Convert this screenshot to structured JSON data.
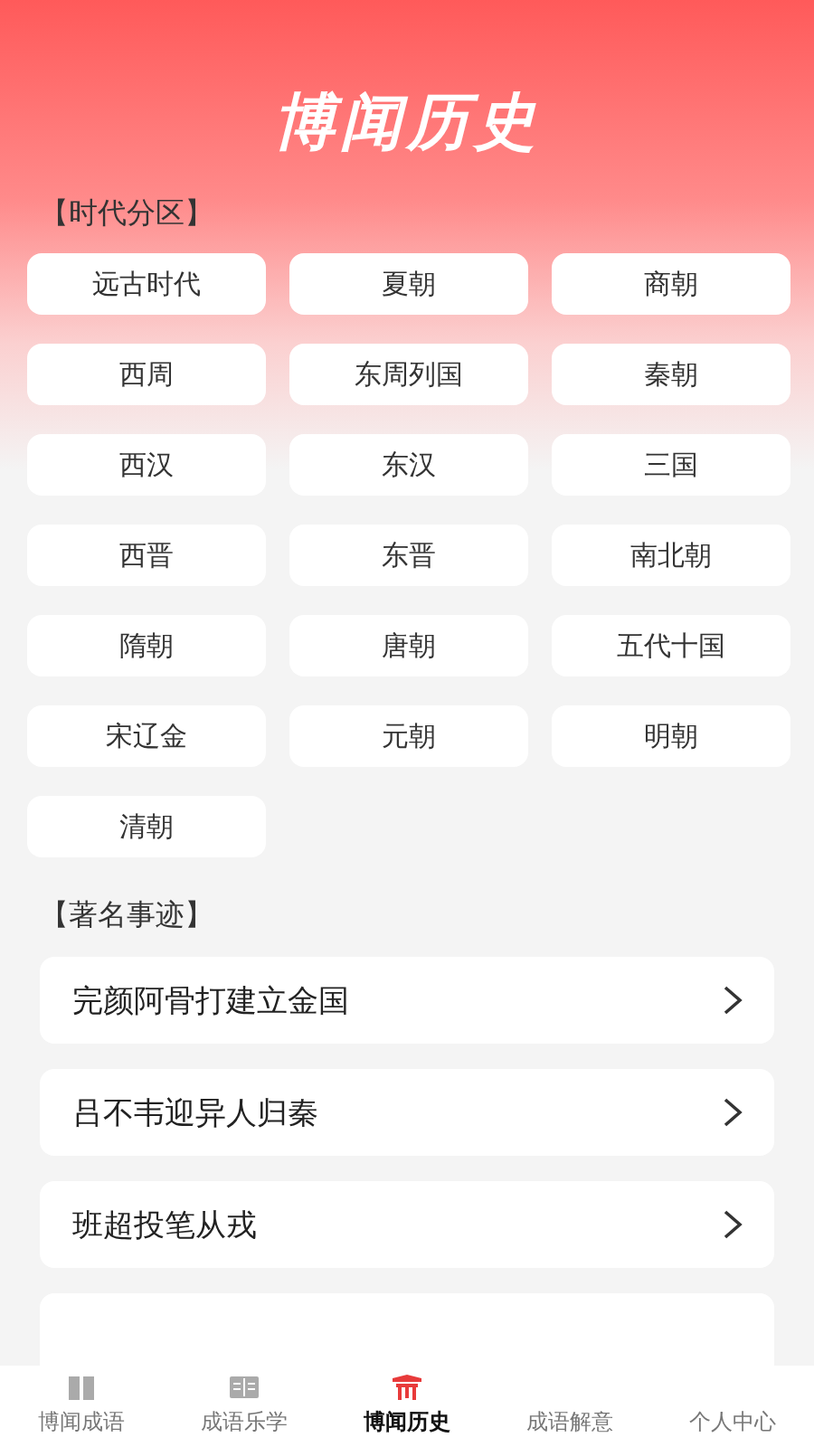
{
  "header": {
    "title": "博闻历史"
  },
  "eras": {
    "heading": "【时代分区】",
    "items": [
      "远古时代",
      "夏朝",
      "商朝",
      "西周",
      "东周列国",
      "秦朝",
      "西汉",
      "东汉",
      "三国",
      "西晋",
      "东晋",
      "南北朝",
      "隋朝",
      "唐朝",
      "五代十国",
      "宋辽金",
      "元朝",
      "明朝",
      "清朝"
    ]
  },
  "events": {
    "heading": "【著名事迹】",
    "items": [
      "完颜阿骨打建立金国",
      "吕不韦迎异人归秦",
      "班超投笔从戎"
    ]
  },
  "tab_bar": [
    {
      "label": "博闻成语",
      "selected": false
    },
    {
      "label": "成语乐学",
      "selected": false
    },
    {
      "label": "博闻历史",
      "selected": true
    },
    {
      "label": "成语解意",
      "selected": false
    },
    {
      "label": "个人中心",
      "selected": false
    }
  ]
}
